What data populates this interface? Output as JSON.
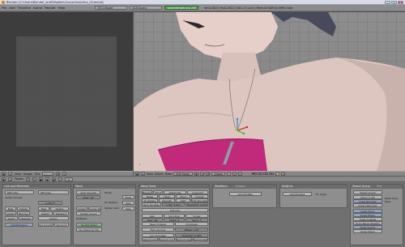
{
  "titlebar": {
    "title": "Blender [C:\\Users\\Blender_stuff\\Models\\Characters\\Hina_04.blend]",
    "minimize": "_",
    "maximize": "□",
    "close": "×"
  },
  "menubar": {
    "items": [
      "File",
      "Add",
      "Timeline",
      "Game",
      "Render",
      "Help"
    ],
    "screen": "SR:2-Model",
    "scene": "SCE:Scene",
    "render_btn": "www.blender.org 245",
    "stats": "Ve:0-1813 | Fa:0-1812 | Ob:1-3 | La:0 | Mem:19.50M (0.09M) Cube"
  },
  "uv_header": {
    "view": "View",
    "image": "Image",
    "uvs": "UVs"
  },
  "vp_header": {
    "view": "View",
    "select": "Select",
    "mesh": "Mesh",
    "mode": "Edit Mode",
    "global": "Global",
    "axis": "(1) Cube"
  },
  "btn_header": {
    "panels": "Panels",
    "frame": "1"
  },
  "panels": {
    "link_materials": {
      "title": "Link and Materials",
      "me": "ME:Cube",
      "ob": "OB:Cube",
      "vertex_groups": "Vertex Groups",
      "mat_count": "0 Mat 0",
      "new": "New",
      "delete": "Delete",
      "copy_group": "Copy Group",
      "assign": "Assign",
      "remove": "Remove",
      "select": "Select",
      "deselect": "Deselect",
      "autotexspace": "AutoTexSpace",
      "set_smooth": "Set Smooth",
      "set_solid": "Set Solid"
    },
    "mesh": {
      "title": "Mesh",
      "auto_smooth": "Auto Smooth",
      "degr": "Degr: 30",
      "sticky": "Sticky",
      "uv_texture": "UV Texture",
      "vertex_color": "Vertex Color",
      "make": "Make",
      "new": "New",
      "texmesh": "TexMesh:",
      "center": "Center",
      "center_new": "Center New",
      "center_cursor": "Center Cursor",
      "double_sided": "Double Sided",
      "no_vnormal_flip": "No V.Normal Flip"
    },
    "mesh_tools": {
      "title": "Mesh Tools",
      "beauty": "Beauty",
      "short": "Short",
      "subdivide": "Subdivide",
      "innervert": "Innervert",
      "noise": "Noise",
      "hash": "Hash",
      "xsort": "Xsort",
      "fractal": "Fractal",
      "to_sphere": "To Sphere",
      "smooth": "Smooth",
      "split": "Split",
      "flip_normals": "Flip Normals",
      "rem_doubles": "Rem Doubles",
      "limit": "Limit: 0.001",
      "threshold": "Threshold: 0.010",
      "extrude": "Extrude",
      "spin": "Spin",
      "spin_dup": "Spin Dup",
      "screw": "Screw",
      "degr": "Degr: 90",
      "steps": "Steps: 9",
      "turns": "Turns: 1",
      "keep_original": "Keep Original",
      "clockwise": "Clockwise",
      "extrude_dup": "Extrude Dup",
      "offset": "Offset: 1.00",
      "join_triangles": "Join Triangles",
      "threshold2": "Threshold 0.800",
      "delimit_uvs": "Delimit UVs",
      "delimit_vcol": "Delimit Vcol",
      "delimit_sharp": "Delimit Sharp",
      "delimit_mat": "Delimit Mat"
    },
    "modifiers": {
      "title": "Modifiers",
      "tab2": "Shapes",
      "add_modifier": "Add Modifier",
      "to": "To: Cube"
    },
    "multires": {
      "title": "Multires",
      "add": "Add Multires"
    },
    "select_group": {
      "title": "Select Group",
      "tab2": "UVs",
      "btns": [
        "Select Group",
        "Mirror X OR",
        "Draw Normals",
        "Draw VNormals",
        "Draw Faces",
        "Draw Edges",
        "Draw Creases",
        "Draw Bevel Weights",
        "Draw Seams",
        "Draw Sharp"
      ],
      "mesh_label": "Mesh Tools More"
    }
  }
}
